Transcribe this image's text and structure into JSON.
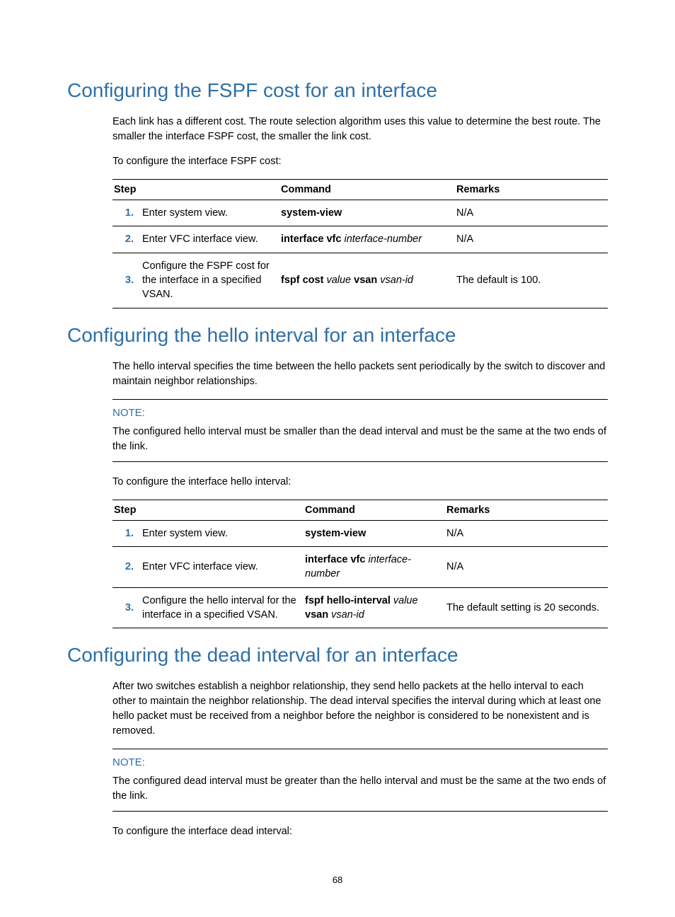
{
  "section1": {
    "title": "Configuring the FSPF cost for an interface",
    "para1": "Each link has a different cost. The route selection algorithm uses this value to determine the best route. The smaller the interface FSPF cost, the smaller the link cost.",
    "para2": "To configure the interface FSPF cost:",
    "th_step": "Step",
    "th_cmd": "Command",
    "th_rem": "Remarks",
    "rows": [
      {
        "num": "1.",
        "desc": "Enter system view.",
        "cmd_html": "<b>system-view</b>",
        "rem": "N/A"
      },
      {
        "num": "2.",
        "desc": "Enter VFC interface view.",
        "cmd_html": "<b>interface vfc</b> <i>interface-number</i>",
        "rem": "N/A"
      },
      {
        "num": "3.",
        "desc": "Configure the FSPF cost for the interface in a specified VSAN.",
        "cmd_html": "<b>fspf cost</b> <i>value</i> <b>vsan</b> <i>vsan-id</i>",
        "rem": "The default is 100."
      }
    ]
  },
  "section2": {
    "title": "Configuring the hello interval for an interface",
    "para1": "The hello interval specifies the time between the hello packets sent periodically by the switch to discover and maintain neighbor relationships.",
    "note_label": "NOTE:",
    "note_text": "The configured hello interval must be smaller than the dead interval and must be the same at the two ends of the link.",
    "para2": "To configure the interface hello interval:",
    "th_step": "Step",
    "th_cmd": "Command",
    "th_rem": "Remarks",
    "rows": [
      {
        "num": "1.",
        "desc": "Enter system view.",
        "cmd_html": "<b>system-view</b>",
        "rem": "N/A"
      },
      {
        "num": "2.",
        "desc": "Enter VFC interface view.",
        "cmd_html": "<b>interface vfc</b> <i>interface-number</i>",
        "rem": "N/A"
      },
      {
        "num": "3.",
        "desc": "Configure the hello interval for the interface in a specified VSAN.",
        "cmd_html": "<b>fspf hello-interval</b> <i>value</i> <b>vsan</b> <i>vsan-id</i>",
        "rem": "The default setting is 20 seconds."
      }
    ]
  },
  "section3": {
    "title": "Configuring the dead interval for an interface",
    "para1": "After two switches establish a neighbor relationship, they send hello packets at the hello interval to each other to maintain the neighbor relationship. The dead interval specifies the interval during which at least one hello packet must be received from a neighbor before the neighbor is considered to be nonexistent and is removed.",
    "note_label": "NOTE:",
    "note_text": "The configured dead interval must be greater than the hello interval and must be the same at the two ends of the link.",
    "para2": "To configure the interface dead interval:"
  },
  "pagenum": "68"
}
